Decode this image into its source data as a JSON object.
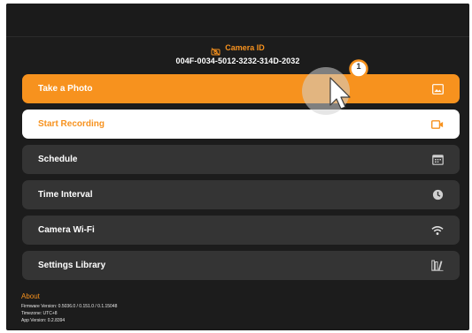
{
  "header": {
    "camera_id_label": "Camera ID",
    "camera_id_value": "004F-0034-5012-3232-314D-2032"
  },
  "menu": [
    {
      "label": "Take a Photo",
      "icon": "image-icon",
      "style": "orange"
    },
    {
      "label": "Start Recording",
      "icon": "video-camera-icon",
      "style": "white"
    },
    {
      "label": "Schedule",
      "icon": "calendar-icon",
      "style": "dark"
    },
    {
      "label": "Time Interval",
      "icon": "clock-icon",
      "style": "dark"
    },
    {
      "label": "Camera Wi-Fi",
      "icon": "wifi-icon",
      "style": "dark"
    },
    {
      "label": "Settings Library",
      "icon": "library-icon",
      "style": "dark"
    }
  ],
  "about": {
    "title": "About",
    "firmware": "Firmware Version: 0.5036.0 / 0.151.0 / 0.1.15048",
    "timezone": "Timezone: UTC+8",
    "app_version": "App Version: 0.2.8394"
  },
  "pointer": {
    "step_number": "1"
  },
  "colors": {
    "accent": "#f7921e",
    "background": "#1c1c1c",
    "button_dark": "#343434"
  }
}
